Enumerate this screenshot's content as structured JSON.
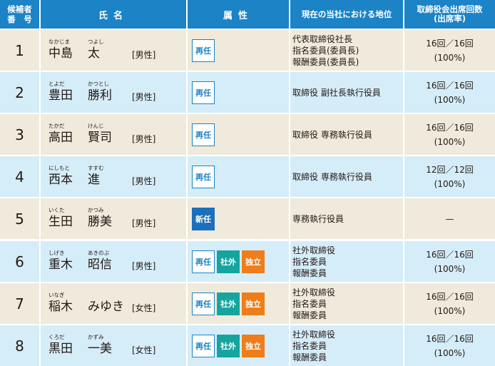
{
  "header": {
    "num_l1": "候補者",
    "num_l2": "番　号",
    "name": "氏名",
    "attr": "属性",
    "position": "現在の当社における地位",
    "attend_l1": "取締役会出席回数",
    "attend_l2": "(出席率)"
  },
  "colors": {
    "header": "#1b83c6",
    "row_odd": "#efeadb",
    "row_even": "#d5edf9",
    "badge_reappoint": "#1b83c6",
    "badge_new": "#1b6fbb",
    "badge_outside": "#16a49f",
    "badge_independent": "#ee7d1a"
  },
  "candidates": [
    {
      "no": "1",
      "family": "中島",
      "given": "太",
      "family_ruby": "なかじま",
      "given_ruby": "つよし",
      "gender": "[男性]",
      "badges": [
        {
          "label": "再任",
          "style": "white"
        }
      ],
      "position": [
        "代表取締役社長",
        "指名委員(委員長)",
        "報酬委員(委員長)"
      ],
      "attendance": "16回／16回",
      "rate": "(100%)"
    },
    {
      "no": "2",
      "family": "豊田",
      "given": "勝利",
      "family_ruby": "とよだ",
      "given_ruby": "かつとし",
      "gender": "[男性]",
      "badges": [
        {
          "label": "再任",
          "style": "white"
        }
      ],
      "position": [
        "取締役 副社長執行役員"
      ],
      "attendance": "16回／16回",
      "rate": "(100%)"
    },
    {
      "no": "3",
      "family": "高田",
      "given": "賢司",
      "family_ruby": "たかだ",
      "given_ruby": "けんじ",
      "gender": "[男性]",
      "badges": [
        {
          "label": "再任",
          "style": "white"
        }
      ],
      "position": [
        "取締役 専務執行役員"
      ],
      "attendance": "16回／16回",
      "rate": "(100%)"
    },
    {
      "no": "4",
      "family": "西本",
      "given": "進",
      "family_ruby": "にしもと",
      "given_ruby": "すすむ",
      "gender": "[男性]",
      "badges": [
        {
          "label": "再任",
          "style": "white"
        }
      ],
      "position": [
        "取締役 専務執行役員"
      ],
      "attendance": "12回／12回",
      "rate": "(100%)"
    },
    {
      "no": "5",
      "family": "生田",
      "given": "勝美",
      "family_ruby": "いくた",
      "given_ruby": "かつみ",
      "gender": "[男性]",
      "badges": [
        {
          "label": "新任",
          "style": "blue"
        }
      ],
      "position": [
        "専務執行役員"
      ],
      "attendance": "—",
      "rate": ""
    },
    {
      "no": "6",
      "family": "重木",
      "given": "昭信",
      "family_ruby": "しげき",
      "given_ruby": "あきのぶ",
      "gender": "[男性]",
      "badges": [
        {
          "label": "再任",
          "style": "white"
        },
        {
          "label": "社外",
          "style": "teal"
        },
        {
          "label": "独立",
          "style": "orange"
        }
      ],
      "position": [
        "社外取締役",
        "指名委員",
        "報酬委員"
      ],
      "attendance": "16回／16回",
      "rate": "(100%)"
    },
    {
      "no": "7",
      "family": "稲木",
      "given": "みゆき",
      "family_ruby": "いなぎ",
      "given_ruby": "",
      "gender": "[女性]",
      "badges": [
        {
          "label": "再任",
          "style": "white"
        },
        {
          "label": "社外",
          "style": "teal"
        },
        {
          "label": "独立",
          "style": "orange"
        }
      ],
      "position": [
        "社外取締役",
        "指名委員",
        "報酬委員"
      ],
      "attendance": "16回／16回",
      "rate": "(100%)"
    },
    {
      "no": "8",
      "family": "黒田",
      "given": "一美",
      "family_ruby": "くろだ",
      "given_ruby": "かずみ",
      "gender": "[女性]",
      "badges": [
        {
          "label": "再任",
          "style": "white"
        },
        {
          "label": "社外",
          "style": "teal"
        },
        {
          "label": "独立",
          "style": "orange"
        }
      ],
      "position": [
        "社外取締役",
        "指名委員",
        "報酬委員"
      ],
      "attendance": "16回／16回",
      "rate": "(100%)"
    }
  ]
}
